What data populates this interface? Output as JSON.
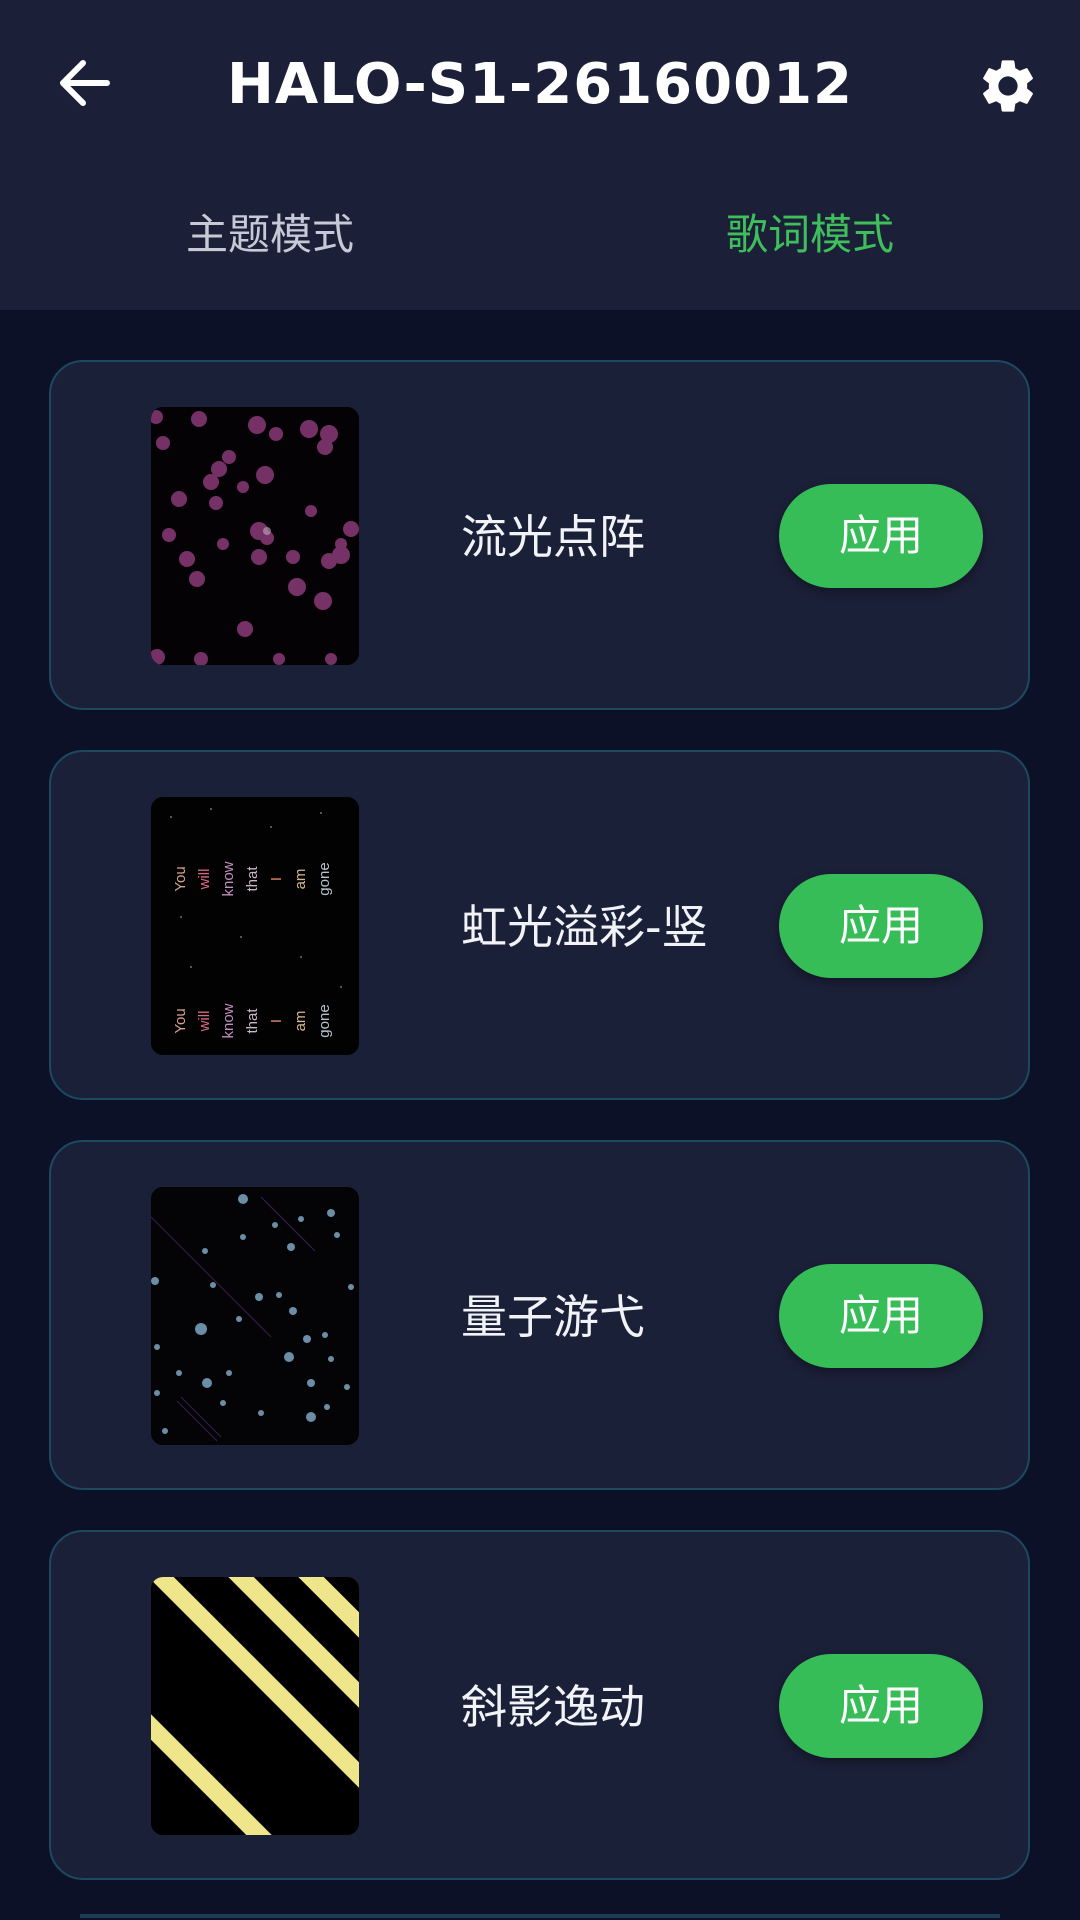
{
  "header": {
    "title": "HALO-S1-26160012",
    "back_icon": "arrow-left-icon",
    "settings_icon": "gear-icon"
  },
  "tabs": [
    {
      "label": "主题模式",
      "active": false
    },
    {
      "label": "歌词模式",
      "active": true
    }
  ],
  "colors": {
    "header_bg": "#1b2038",
    "page_bg": "#0c1128",
    "card_bg": "#1b2039",
    "card_border": "#1d4960",
    "accent_green": "#36bd58",
    "active_tab": "#3fbf5c"
  },
  "effects": [
    {
      "name": "流光点阵",
      "button_label": "应用",
      "preview": "purple-dots-preview"
    },
    {
      "name": "虹光溢彩-竖",
      "button_label": "应用",
      "preview": "vertical-lyrics-preview",
      "preview_words": [
        "You",
        "will",
        "know",
        "that",
        "I",
        "am",
        "gone"
      ]
    },
    {
      "name": "量子游弋",
      "button_label": "应用",
      "preview": "quantum-particles-preview"
    },
    {
      "name": "斜影逸动",
      "button_label": "应用",
      "preview": "diagonal-stripes-preview"
    }
  ]
}
